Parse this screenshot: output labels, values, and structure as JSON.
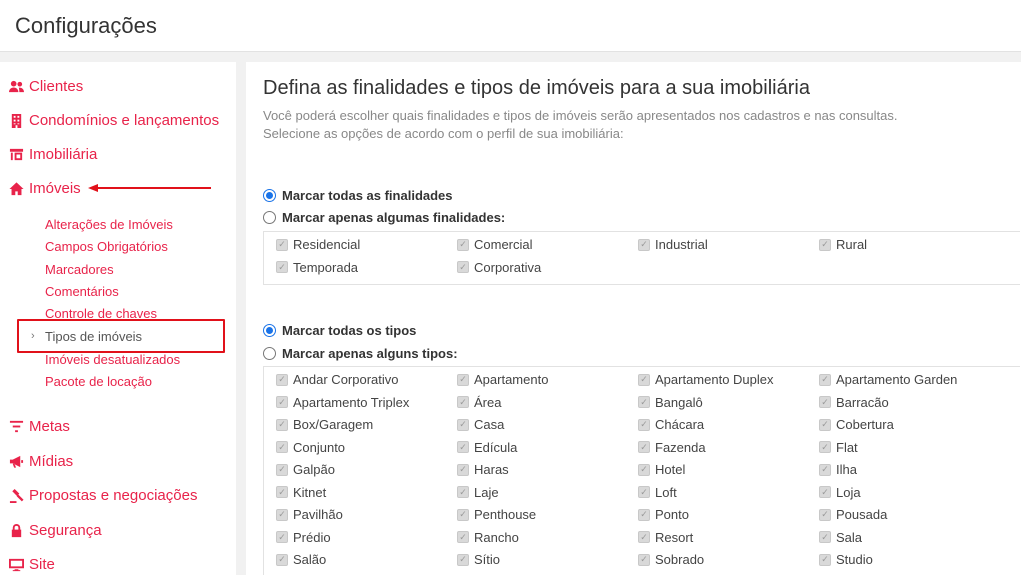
{
  "header": {
    "title": "Configurações"
  },
  "sidebar": {
    "items": [
      {
        "label": "Clientes",
        "icon": "users-icon"
      },
      {
        "label": "Condomínios e lançamentos",
        "icon": "building-icon"
      },
      {
        "label": "Imobiliária",
        "icon": "storefront-icon"
      },
      {
        "label": "Imóveis",
        "icon": "home-icon"
      },
      {
        "label": "Metas",
        "icon": "filter-icon"
      },
      {
        "label": "Mídias",
        "icon": "megaphone-icon"
      },
      {
        "label": "Propostas e negociações",
        "icon": "gavel-icon"
      },
      {
        "label": "Segurança",
        "icon": "lock-icon"
      },
      {
        "label": "Site",
        "icon": "monitor-icon"
      }
    ],
    "subitems": [
      {
        "label": "Alterações de Imóveis"
      },
      {
        "label": "Campos Obrigatórios"
      },
      {
        "label": "Marcadores"
      },
      {
        "label": "Comentários"
      },
      {
        "label": "Controle de chaves"
      },
      {
        "label": "Tipos de imóveis",
        "active": true
      },
      {
        "label": "Imóveis desatualizados"
      },
      {
        "label": "Pacote de locação"
      }
    ],
    "chevron": "›"
  },
  "main": {
    "title": "Defina as finalidades e tipos de imóveis para a sua imobiliária",
    "desc1": "Você poderá escolher quais finalidades e tipos de imóveis serão apresentados nos cadastros e nas consultas.",
    "desc2": "Selecione as opções de acordo com o perfil de sua imobiliária:",
    "finalidades": {
      "all_label": "Marcar todas as finalidades",
      "some_label": "Marcar apenas algumas finalidades:",
      "options": [
        "Residencial",
        "Comercial",
        "Industrial",
        "Rural",
        "Temporada",
        "Corporativa"
      ]
    },
    "tipos": {
      "all_label": "Marcar todas os tipos",
      "some_label": "Marcar apenas alguns tipos:",
      "options": [
        "Andar Corporativo",
        "Apartamento",
        "Apartamento Duplex",
        "Apartamento Garden",
        "Apartamento Triplex",
        "Área",
        "Bangalô",
        "Barracão",
        "Box/Garagem",
        "Casa",
        "Chácara",
        "Cobertura",
        "Conjunto",
        "Edícula",
        "Fazenda",
        "Flat",
        "Galpão",
        "Haras",
        "Hotel",
        "Ilha",
        "Kitnet",
        "Laje",
        "Loft",
        "Loja",
        "Pavilhão",
        "Penthouse",
        "Ponto",
        "Pousada",
        "Prédio",
        "Rancho",
        "Resort",
        "Sala",
        "Salão",
        "Sítio",
        "Sobrado",
        "Studio"
      ]
    }
  },
  "colors": {
    "accent": "#e8234a",
    "radio": "#1a73e8",
    "annotation": "#e1111a"
  }
}
